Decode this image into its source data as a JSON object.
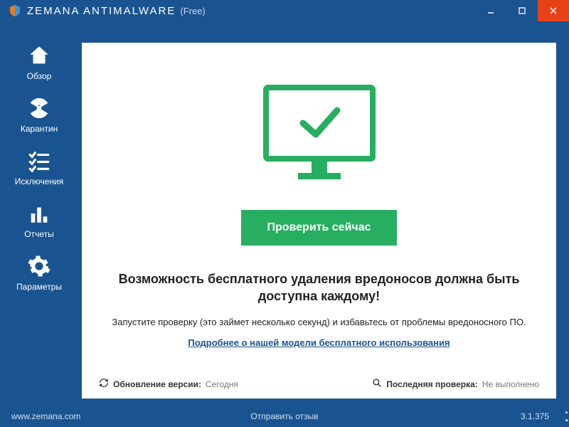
{
  "title": {
    "brand": "ZEMANA ANTIMALWARE",
    "edition": "(Free)"
  },
  "sidebar": {
    "items": [
      {
        "label": "Обзор"
      },
      {
        "label": "Карантин"
      },
      {
        "label": "Исключения"
      },
      {
        "label": "Отчеты"
      },
      {
        "label": "Параметры"
      }
    ]
  },
  "main": {
    "scan_button": "Проверить сейчас",
    "headline": "Возможность бесплатного удаления вредоносов должна быть доступна каждому!",
    "subtext": "Запустите проверку (это займет несколько секунд) и избавьтесь от проблемы вредоносного ПО.",
    "learn_more": "Подробнее о нашей модели бесплатного использования"
  },
  "status": {
    "update_label": "Обновление версии:",
    "update_value": "Сегодня",
    "lastscan_label": "Последняя проверка:",
    "lastscan_value": "Не выполнено"
  },
  "footer": {
    "site": "www.zemana.com",
    "feedback": "Отправить отзыв",
    "version": "3.1.375"
  },
  "colors": {
    "accent": "#27ae60",
    "brand_bg": "#1a5490",
    "close": "#e84118"
  }
}
